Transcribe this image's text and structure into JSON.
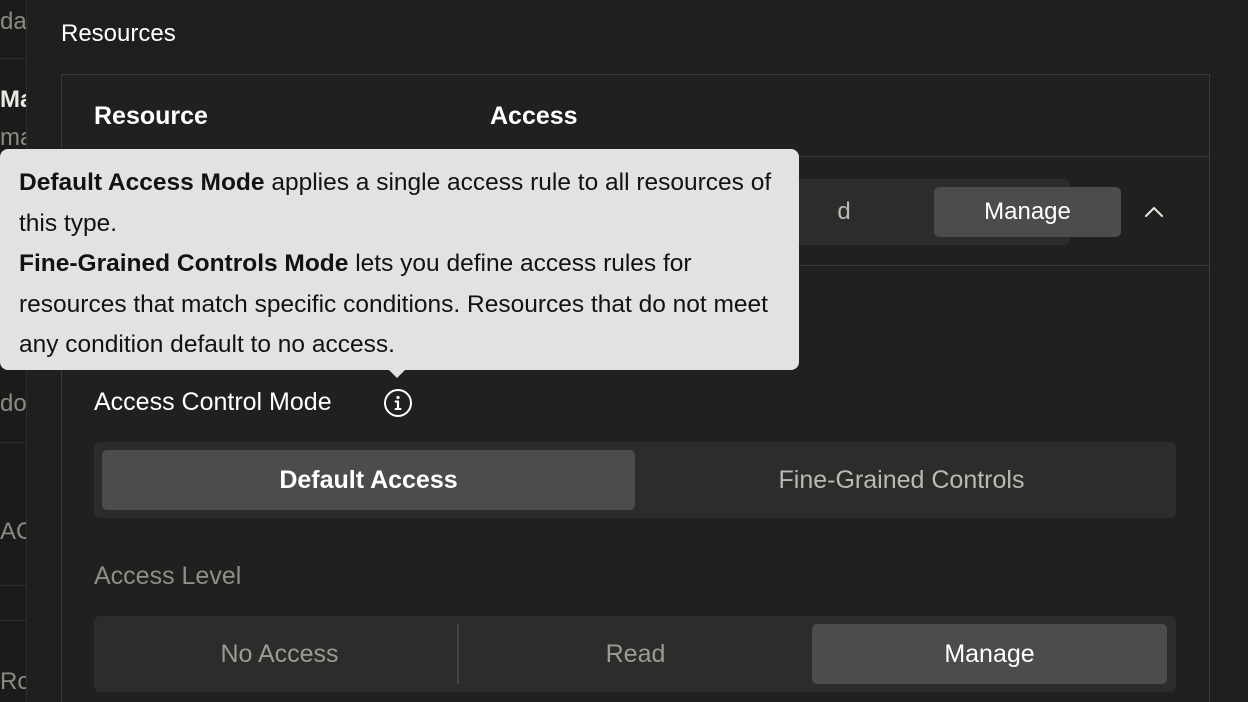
{
  "sidebar_fragments": [
    "da",
    "Ma",
    "ma",
    "do",
    "AC",
    "Ro"
  ],
  "section": {
    "title": "Resources"
  },
  "table": {
    "headers": [
      "Resource",
      "Access"
    ],
    "row": {
      "segment_read": "d",
      "segment_manage": "Manage"
    }
  },
  "tooltip": {
    "line1_bold": "Default Access Mode",
    "line1_rest": " applies a single access rule to all resources of this type.",
    "line2_bold": "Fine-Grained Controls Mode",
    "line2_rest": " lets you define access rules for resources that match specific conditions. Resources that do not meet any condition default to no access."
  },
  "access_control_mode": {
    "label": "Access Control Mode",
    "options": [
      "Default Access",
      "Fine-Grained Controls"
    ],
    "selected": "Default Access"
  },
  "access_level": {
    "label": "Access Level",
    "options": [
      "No Access",
      "Read",
      "Manage"
    ],
    "selected": "Manage"
  },
  "icons": {
    "info": "info-icon",
    "chevron": "chevron-up-icon"
  },
  "colors": {
    "background": "#1f1f1d",
    "tooltip_bg": "#e2e2e0",
    "active_segment": "#4c4c4a"
  }
}
